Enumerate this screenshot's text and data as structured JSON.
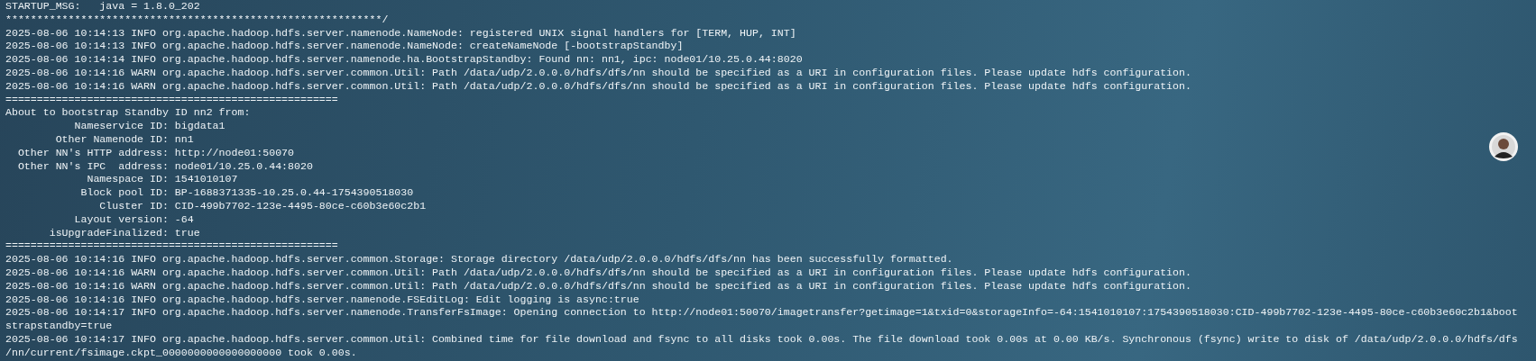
{
  "terminal": {
    "lines": [
      "STARTUP_MSG:   java = 1.8.0_202",
      "************************************************************/",
      "2025-08-06 10:14:13 INFO org.apache.hadoop.hdfs.server.namenode.NameNode: registered UNIX signal handlers for [TERM, HUP, INT]",
      "2025-08-06 10:14:13 INFO org.apache.hadoop.hdfs.server.namenode.NameNode: createNameNode [-bootstrapStandby]",
      "2025-08-06 10:14:14 INFO org.apache.hadoop.hdfs.server.namenode.ha.BootstrapStandby: Found nn: nn1, ipc: node01/10.25.0.44:8020",
      "2025-08-06 10:14:16 WARN org.apache.hadoop.hdfs.server.common.Util: Path /data/udp/2.0.0.0/hdfs/dfs/nn should be specified as a URI in configuration files. Please update hdfs configuration.",
      "2025-08-06 10:14:16 WARN org.apache.hadoop.hdfs.server.common.Util: Path /data/udp/2.0.0.0/hdfs/dfs/nn should be specified as a URI in configuration files. Please update hdfs configuration.",
      "=====================================================",
      "About to bootstrap Standby ID nn2 from:",
      "           Nameservice ID: bigdata1",
      "        Other Namenode ID: nn1",
      "  Other NN's HTTP address: http://node01:50070",
      "  Other NN's IPC  address: node01/10.25.0.44:8020",
      "             Namespace ID: 1541010107",
      "            Block pool ID: BP-1688371335-10.25.0.44-1754390518030",
      "               Cluster ID: CID-499b7702-123e-4495-80ce-c60b3e60c2b1",
      "           Layout version: -64",
      "       isUpgradeFinalized: true",
      "=====================================================",
      "2025-08-06 10:14:16 INFO org.apache.hadoop.hdfs.server.common.Storage: Storage directory /data/udp/2.0.0.0/hdfs/dfs/nn has been successfully formatted.",
      "2025-08-06 10:14:16 WARN org.apache.hadoop.hdfs.server.common.Util: Path /data/udp/2.0.0.0/hdfs/dfs/nn should be specified as a URI in configuration files. Please update hdfs configuration.",
      "2025-08-06 10:14:16 WARN org.apache.hadoop.hdfs.server.common.Util: Path /data/udp/2.0.0.0/hdfs/dfs/nn should be specified as a URI in configuration files. Please update hdfs configuration.",
      "2025-08-06 10:14:16 INFO org.apache.hadoop.hdfs.server.namenode.FSEditLog: Edit logging is async:true",
      "2025-08-06 10:14:17 INFO org.apache.hadoop.hdfs.server.namenode.TransferFsImage: Opening connection to http://node01:50070/imagetransfer?getimage=1&txid=0&storageInfo=-64:1541010107:1754390518030:CID-499b7702-123e-4495-80ce-c60b3e60c2b1&boot",
      "strapstandby=true",
      "2025-08-06 10:14:17 INFO org.apache.hadoop.hdfs.server.common.Util: Combined time for file download and fsync to all disks took 0.00s. The file download took 0.00s at 0.00 KB/s. Synchronous (fsync) write to disk of /data/udp/2.0.0.0/hdfs/dfs",
      "/nn/current/fsimage.ckpt_0000000000000000000 took 0.00s."
    ]
  }
}
